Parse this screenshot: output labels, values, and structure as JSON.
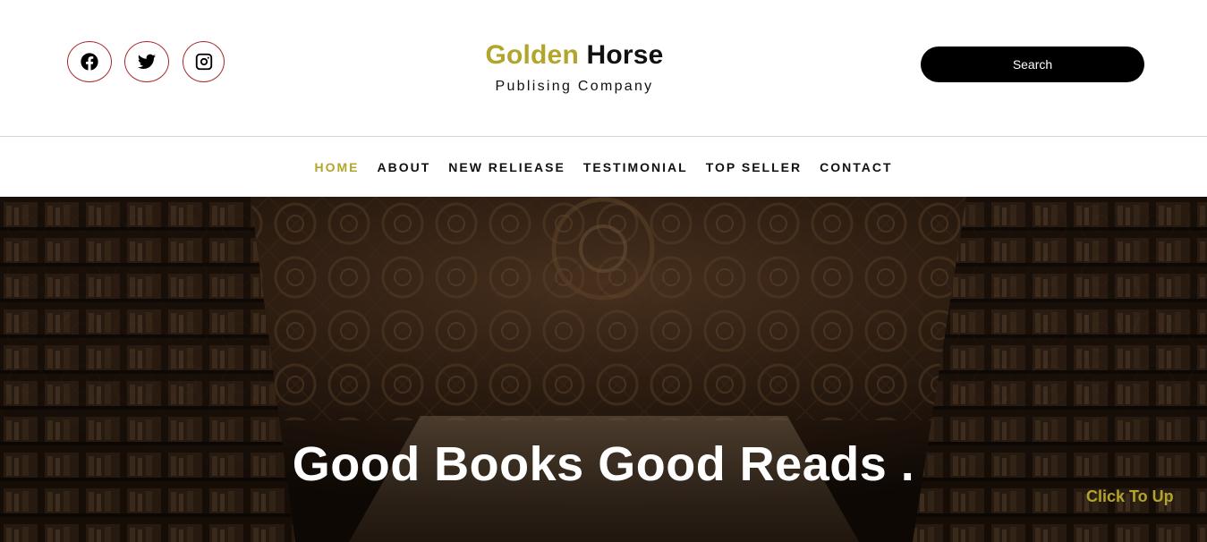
{
  "header": {
    "social": [
      {
        "name": "facebook",
        "icon": "facebook-icon"
      },
      {
        "name": "twitter",
        "icon": "twitter-icon"
      },
      {
        "name": "instagram",
        "icon": "instagram-icon"
      }
    ],
    "brand": {
      "title_first": "Golden",
      "title_second": "Horse",
      "subtitle": "Publising Company"
    },
    "search_label": "Search"
  },
  "nav": {
    "items": [
      {
        "label": "HOME",
        "active": true
      },
      {
        "label": "ABOUT",
        "active": false
      },
      {
        "label": "NEW RELIEASE",
        "active": false
      },
      {
        "label": "TESTIMONIAL",
        "active": false
      },
      {
        "label": "TOP SELLER",
        "active": false
      },
      {
        "label": "CONTACT",
        "active": false
      }
    ]
  },
  "hero": {
    "title": "Good Books Good Reads .",
    "background": "library-interior-image"
  },
  "to_top_label": "Click To Up",
  "colors": {
    "accent": "#b1a52a",
    "social_border": "#a52a2a",
    "button": "#000000",
    "text": "#111111"
  }
}
